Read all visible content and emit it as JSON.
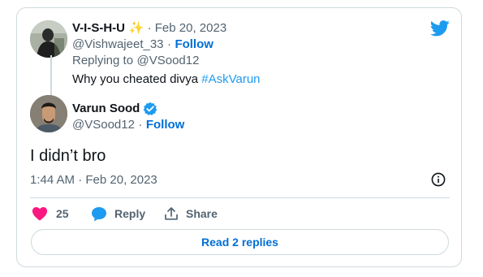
{
  "reply_parent": {
    "display_name": "V-I-S-H-U",
    "name_emoji": "✨",
    "date": "· Feb 20, 2023",
    "handle": "@Vishwajeet_33",
    "handle_sep": "·",
    "follow_label": "Follow",
    "replying_to_prefix": "Replying to",
    "replying_to_handle": "@VSood12",
    "text": "Why you cheated divya",
    "hashtag": "#AskVarun"
  },
  "tweet": {
    "display_name": "Varun Sood",
    "handle": "@VSood12",
    "handle_sep": "·",
    "follow_label": "Follow",
    "text": "I didn’t bro",
    "timestamp": "1:44 AM · Feb 20, 2023"
  },
  "actions": {
    "like_count": "25",
    "reply_label": "Reply",
    "share_label": "Share"
  },
  "read_replies_label": "Read 2 replies",
  "icons": {
    "brand": "twitter-bird-icon",
    "verified": "verified-badge-icon",
    "info": "info-icon",
    "like": "heart-icon",
    "reply": "speech-bubble-icon",
    "share": "share-upload-icon"
  },
  "colors": {
    "twitter_blue": "#1d9bf0",
    "follow_blue": "#006fd6",
    "like_pink": "#f91880",
    "muted": "#536471",
    "border": "#cfd9de"
  }
}
